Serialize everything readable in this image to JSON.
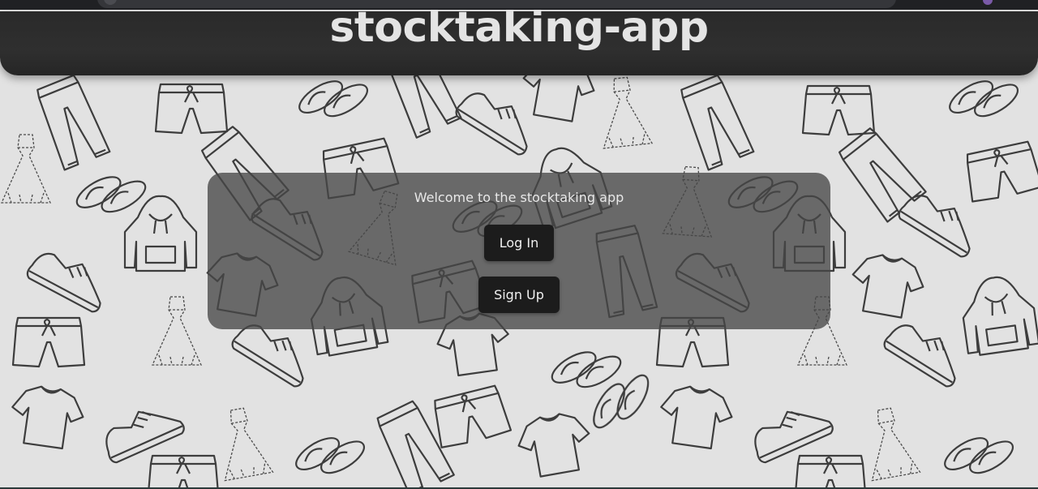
{
  "app": {
    "title": "stocktaking-app"
  },
  "welcome": {
    "message": "Welcome to the stocktaking app",
    "login_label": "Log In",
    "signup_label": "Sign Up"
  },
  "colors": {
    "header_bg": "#2a2a2a",
    "title_color": "#e4e4e4",
    "card_bg": "#464646",
    "button_bg": "#1c1c1c",
    "page_bg": "#e2e2e2",
    "pattern_stroke": "#2b2b2b"
  },
  "background": {
    "icons": [
      "shirt-icon",
      "shorts-icon",
      "pants-icon",
      "hoodie-icon",
      "sneaker-icon",
      "dress-icon",
      "flip-flops-icon"
    ]
  }
}
